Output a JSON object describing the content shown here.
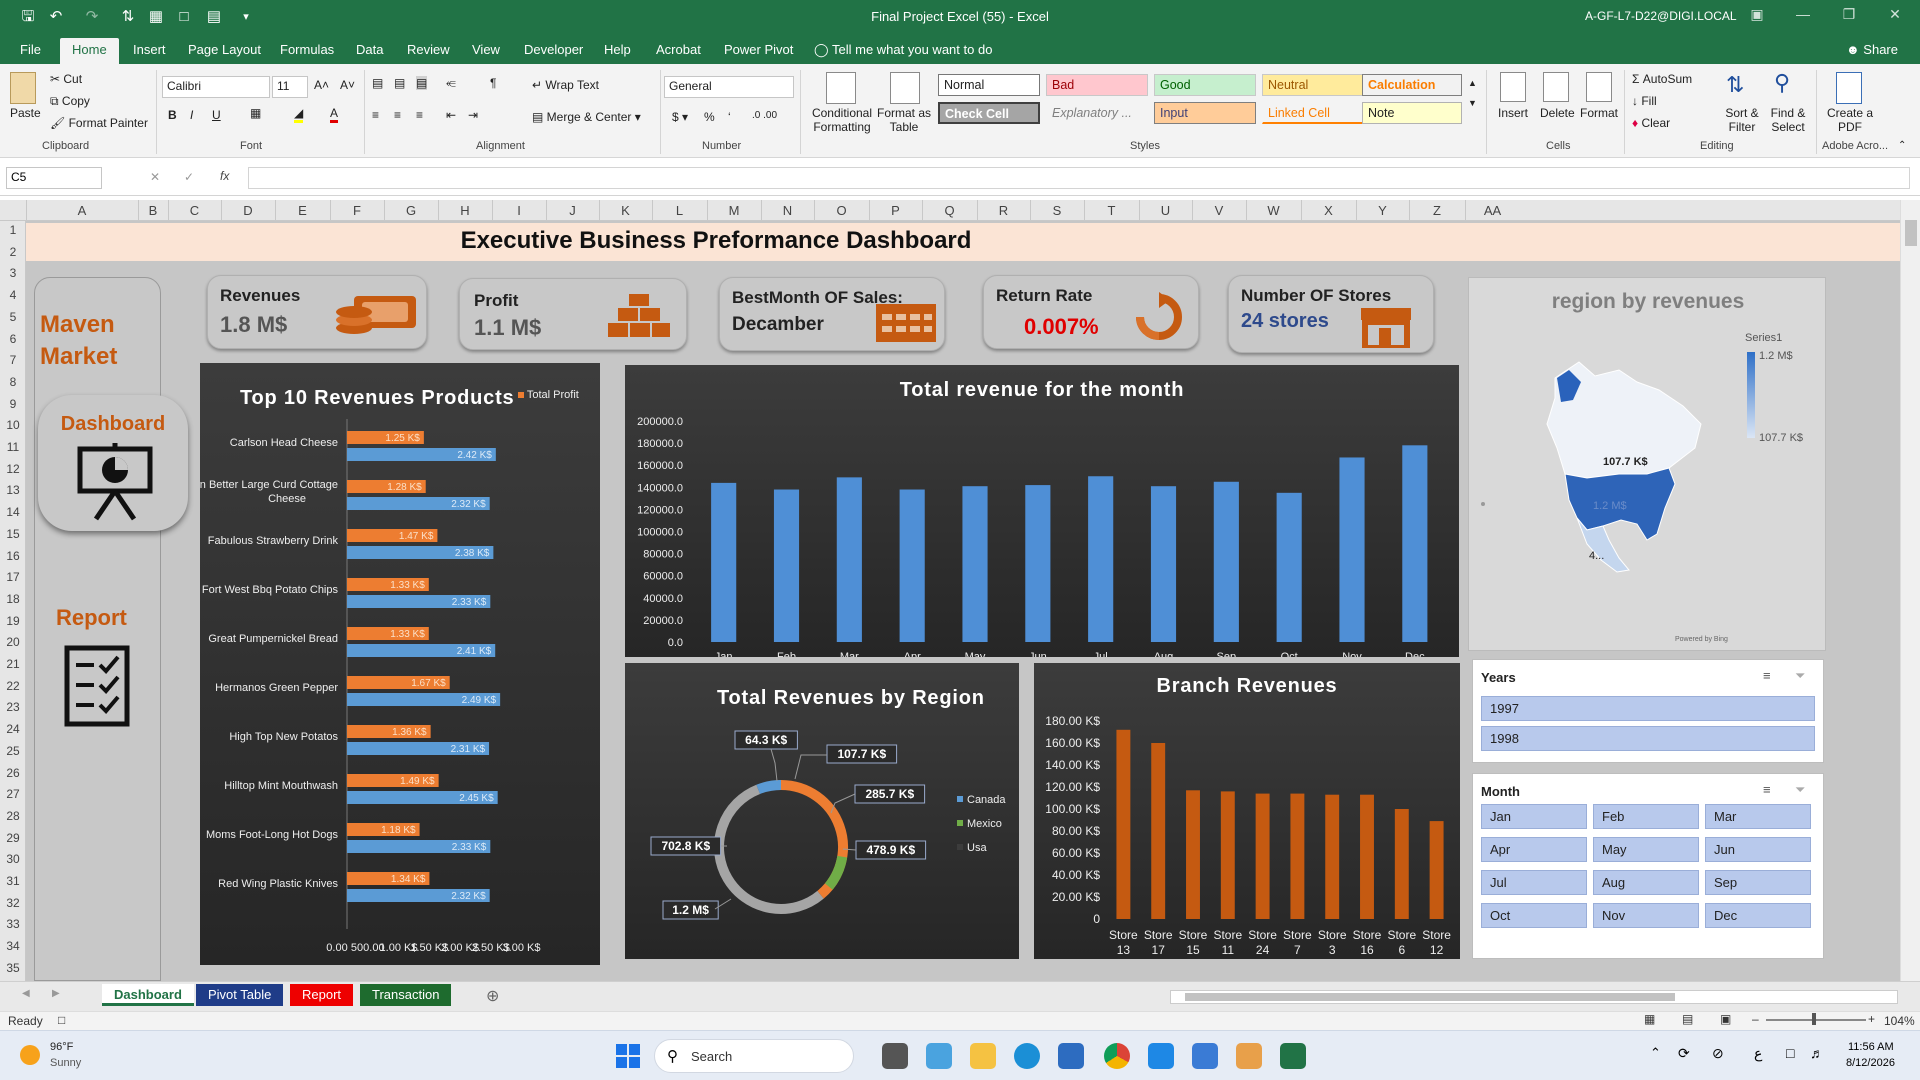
{
  "window": {
    "title": "Final Project Excel (55)  -  Excel",
    "account": "A-GF-L7-D22@DIGI.LOCAL"
  },
  "menu": {
    "tabs": [
      "File",
      "Home",
      "Insert",
      "Page Layout",
      "Formulas",
      "Data",
      "Review",
      "View",
      "Developer",
      "Help",
      "Acrobat",
      "Power Pivot"
    ],
    "tell_me": "Tell me what you want to do",
    "share": "Share"
  },
  "ribbon": {
    "clipboard": {
      "paste": "Paste",
      "cut": "Cut",
      "copy": "Copy",
      "format_painter": "Format Painter",
      "label": "Clipboard"
    },
    "font": {
      "name": "Calibri",
      "size": "11",
      "label": "Font"
    },
    "alignment": {
      "wrap": "Wrap Text",
      "merge": "Merge & Center",
      "label": "Alignment"
    },
    "number": {
      "format": "General",
      "label": "Number"
    },
    "styles": {
      "conditional": "Conditional Formatting",
      "format_table": "Format as Table",
      "cells": [
        "Normal",
        "Bad",
        "Good",
        "Neutral",
        "Calculation",
        "Check Cell",
        "Explanatory ...",
        "Input",
        "Linked Cell",
        "Note"
      ],
      "label": "Styles"
    },
    "cells": {
      "insert": "Insert",
      "delete": "Delete",
      "format": "Format",
      "label": "Cells"
    },
    "editing": {
      "autosum": "AutoSum",
      "fill": "Fill",
      "clear": "Clear",
      "sort": "Sort & Filter",
      "find": "Find & Select",
      "label": "Editing"
    },
    "adobe": {
      "create": "Create a PDF",
      "label": "Adobe Acro..."
    }
  },
  "formula_bar": {
    "name_box": "C5",
    "fx": "fx"
  },
  "columns": [
    "A",
    "B",
    "C",
    "D",
    "E",
    "F",
    "G",
    "H",
    "I",
    "J",
    "K",
    "L",
    "M",
    "N",
    "O",
    "P",
    "Q",
    "R",
    "S",
    "T",
    "U",
    "V",
    "W",
    "X",
    "Y",
    "Z",
    "AA"
  ],
  "rows": [
    "1",
    "2",
    "3",
    "4",
    "5",
    "6",
    "7",
    "8",
    "9",
    "10",
    "11",
    "12",
    "13",
    "14",
    "15",
    "16",
    "17",
    "18",
    "19",
    "20",
    "21",
    "22",
    "23",
    "24",
    "25",
    "26",
    "27",
    "28",
    "29",
    "30",
    "31",
    "32",
    "33",
    "34",
    "35"
  ],
  "dashboard": {
    "title": "Executive Business Preformance Dashboard",
    "brand": "Maven Market",
    "nav": {
      "dashboard": "Dashboard",
      "report": "Report"
    },
    "kpis": [
      {
        "title": "Revenues",
        "value": "1.8 M$"
      },
      {
        "title": "Profit",
        "value": "1.1 M$"
      },
      {
        "title": "BestMonth OF Sales:",
        "value": "Decamber"
      },
      {
        "title": "Return Rate",
        "value": "0.007%"
      },
      {
        "title": "Number OF Stores",
        "value": "24 stores"
      }
    ],
    "colors": {
      "orange": "#ed7d31",
      "blue": "#5b9bd5",
      "red": "#e00000",
      "navy": "#1f4e9c",
      "accent_bg": "#fbe4d5"
    }
  },
  "chart_data": [
    {
      "type": "bar",
      "orientation": "horizontal",
      "title": "Top 10 Revenues Products",
      "legend": "Total Profit",
      "categories": [
        "Carlson Head Cheese",
        "Even Better Large Curd Cottage Cheese",
        "Fabulous Strawberry Drink",
        "Fort West Bbq Potato Chips",
        "Great Pumpernickel Bread",
        "Hermanos Green Pepper",
        "High Top New Potatos",
        "Hilltop Mint Mouthwash",
        "Moms Foot-Long Hot Dogs",
        "Red Wing Plastic Knives"
      ],
      "series": [
        {
          "name": "Total Profit",
          "values": [
            1.25,
            1.28,
            1.47,
            1.33,
            1.33,
            1.67,
            1.36,
            1.49,
            1.18,
            1.34
          ],
          "labels": [
            "1.25 K$",
            "1.28 K$",
            "1.47 K$",
            "1.33 K$",
            "1.33 K$",
            "1.67 K$",
            "1.36 K$",
            "1.49 K$",
            "1.18 K$",
            "1.34 K$"
          ]
        },
        {
          "values": [
            2.42,
            2.32,
            2.38,
            2.33,
            2.41,
            2.49,
            2.31,
            2.45,
            2.33,
            2.32
          ],
          "labels": [
            "2.42 K$",
            "2.32 K$",
            "2.38 K$",
            "2.33 K$",
            "2.41 K$",
            "2.49 K$",
            "2.31 K$",
            "2.45 K$",
            "2.33 K$",
            "2.32 K$"
          ]
        }
      ],
      "xticks": [
        "0.00",
        "500.00",
        "1.00 K$",
        "1.50 K$",
        "2.00 K$",
        "2.50 K$",
        "3.00 K$"
      ],
      "xlim": [
        0,
        3
      ]
    },
    {
      "type": "bar",
      "title": "Total revenue for the month",
      "categories": [
        "Jan",
        "Feb",
        "Mar",
        "Apr",
        "May",
        "Jun",
        "Jul",
        "Aug",
        "Sep",
        "Oct",
        "Nov",
        "Dec"
      ],
      "values": [
        144000,
        138000,
        149000,
        138000,
        141000,
        142000,
        150000,
        141000,
        145000,
        135000,
        167000,
        178000
      ],
      "yticks": [
        "0.0",
        "20000.0",
        "40000.0",
        "60000.0",
        "80000.0",
        "100000.0",
        "120000.0",
        "140000.0",
        "160000.0",
        "180000.0",
        "200000.0"
      ],
      "ylim": [
        0,
        200000
      ]
    },
    {
      "type": "pie",
      "title": "Total Revenues by Region",
      "legend": [
        "Canada",
        "Mexico",
        "Usa"
      ],
      "labels": [
        "64.3 K$",
        "107.7 K$",
        "285.7 K$",
        "478.9 K$",
        "702.8 K$",
        "1.2 M$"
      ],
      "values": [
        64.3,
        107.7,
        285.7,
        478.9,
        702.8,
        1200
      ]
    },
    {
      "type": "bar",
      "title": "Branch Revenues",
      "categories": [
        "Store 13",
        "Store 17",
        "Store 15",
        "Store 11",
        "Store 24",
        "Store 7",
        "Store 3",
        "Store 16",
        "Store 6",
        "Store 12"
      ],
      "values": [
        172,
        160,
        117,
        116,
        114,
        114,
        113,
        113,
        100,
        89
      ],
      "yticks": [
        "0",
        "20.00 K$",
        "40.00 K$",
        "60.00 K$",
        "80.00 K$",
        "100.00 K$",
        "120.00 K$",
        "140.00 K$",
        "160.00 K$",
        "180.00 K$"
      ],
      "ylim": [
        0,
        180
      ]
    },
    {
      "type": "heatmap",
      "title": "region by revenues",
      "legend": "Series1",
      "scale": [
        "1.2 M$",
        "107.7 K$"
      ],
      "labels": [
        "107.7 K$",
        "1.2 M$",
        "4..."
      ],
      "credit": "Powered by Bing"
    }
  ],
  "slicers": {
    "years": {
      "title": "Years",
      "items": [
        "1997",
        "1998"
      ]
    },
    "month": {
      "title": "Month",
      "items": [
        "Jan",
        "Feb",
        "Mar",
        "Apr",
        "May",
        "Jun",
        "Jul",
        "Aug",
        "Sep",
        "Oct",
        "Nov",
        "Dec"
      ]
    }
  },
  "sheets": {
    "tabs": [
      "Dashboard",
      "Pivot Table",
      "Report",
      "Transaction"
    ]
  },
  "status": {
    "ready": "Ready",
    "zoom": "104%"
  },
  "taskbar": {
    "temp": "96°F",
    "weather": "Sunny",
    "search": "Search",
    "time": "11:56 AM",
    "date": "8/12/2026"
  }
}
